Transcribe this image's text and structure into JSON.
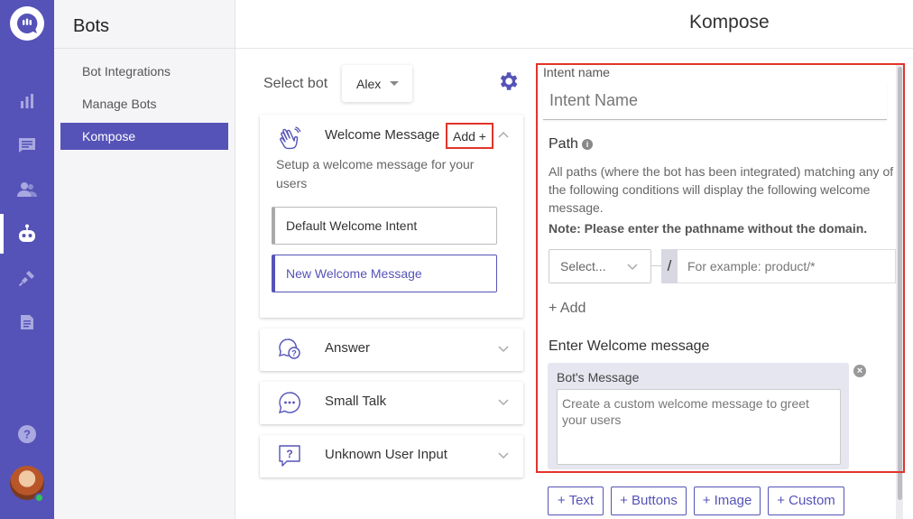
{
  "app": {
    "accent": "#5553b7",
    "highlight": "#e2342b"
  },
  "rail": {
    "items": [
      {
        "name": "dashboard",
        "icon": "bar-chart-icon"
      },
      {
        "name": "conversations",
        "icon": "message-icon"
      },
      {
        "name": "users",
        "icon": "users-icon"
      },
      {
        "name": "bots",
        "icon": "bot-icon",
        "active": true
      },
      {
        "name": "integrations",
        "icon": "plug-icon"
      },
      {
        "name": "reports",
        "icon": "document-icon"
      }
    ],
    "help_icon": "help-icon",
    "status": "online"
  },
  "sidebar": {
    "title": "Bots",
    "items": [
      {
        "label": "Bot Integrations"
      },
      {
        "label": "Manage Bots"
      },
      {
        "label": "Kompose",
        "active": true
      }
    ]
  },
  "header": {
    "title": "Kompose"
  },
  "bot_select": {
    "label": "Select bot",
    "value": "Alex"
  },
  "sections": {
    "welcome": {
      "title": "Welcome Message",
      "add_label": "Add +",
      "description": "Setup a welcome message for your users",
      "intents": [
        {
          "label": "Default Welcome Intent"
        },
        {
          "label": "New Welcome Message",
          "selected": true
        }
      ]
    },
    "answer": {
      "title": "Answer"
    },
    "small_talk": {
      "title": "Small Talk"
    },
    "unknown": {
      "title": "Unknown User Input"
    }
  },
  "editor": {
    "intent_label": "Intent name",
    "intent_placeholder": "Intent Name",
    "path_label": "Path",
    "path_description": "All paths (where the bot has been integrated) matching any of the following conditions will display the following welcome message.",
    "path_note": "Note: Please enter the pathname without the domain.",
    "condition_placeholder": "Select...",
    "slash": "/",
    "path_placeholder": "For example: product/*",
    "add_path": "+ Add",
    "welcome_label": "Enter Welcome message",
    "bot_message_label": "Bot's Message",
    "bot_message_placeholder": "Create a custom welcome message to greet your users",
    "add_buttons": [
      "+ Text",
      "+ Buttons",
      "+ Image",
      "+ Custom"
    ]
  }
}
